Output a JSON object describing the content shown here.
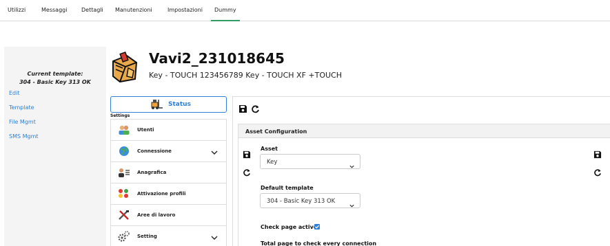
{
  "nav": {
    "tabs": [
      "Utilizzi",
      "Messaggi",
      "Dettagli",
      "Manutenzioni",
      "Impostazioni",
      "Dummy"
    ],
    "active_tab": "Dummy"
  },
  "sidebar": {
    "current_template_label": "Current template:",
    "current_template_value": "304 - Basic Key 313 OK",
    "links": [
      "Edit",
      "Template",
      "File Mgmt",
      "SMS Mgmt"
    ]
  },
  "header": {
    "title": "Vavi2_231018645",
    "subtitle": "Key - TOUCH 123456789 Key - TOUCH XF +TOUCH",
    "logo_icon": "toolbox-icon"
  },
  "menu": {
    "status_label": "Status",
    "settings_label": "Settings",
    "items": [
      {
        "label": "Utenti",
        "icon": "users-icon",
        "expandable": false
      },
      {
        "label": "Connessione",
        "icon": "globe-icon",
        "expandable": true
      },
      {
        "label": "Anagrafica",
        "icon": "id-card-icon",
        "expandable": false
      },
      {
        "label": "Attivazione profili",
        "icon": "traffic-light-icon",
        "expandable": false
      },
      {
        "label": "Aree di lavoro",
        "icon": "tools-icon",
        "expandable": false
      },
      {
        "label": "Setting",
        "icon": "gears-icon",
        "expandable": true
      }
    ]
  },
  "panel": {
    "card_title": "Asset Configuration",
    "asset_label": "Asset",
    "asset_value": "Key",
    "default_template_label": "Default template",
    "default_template_value": "304 - Basic Key 313 OK",
    "check_page_label": "Check page active",
    "check_page_checked": true,
    "total_page_label": "Total page to check every connection"
  },
  "colors": {
    "accent": "#2f7fd8",
    "active_tab_underline": "#2f9b62"
  }
}
